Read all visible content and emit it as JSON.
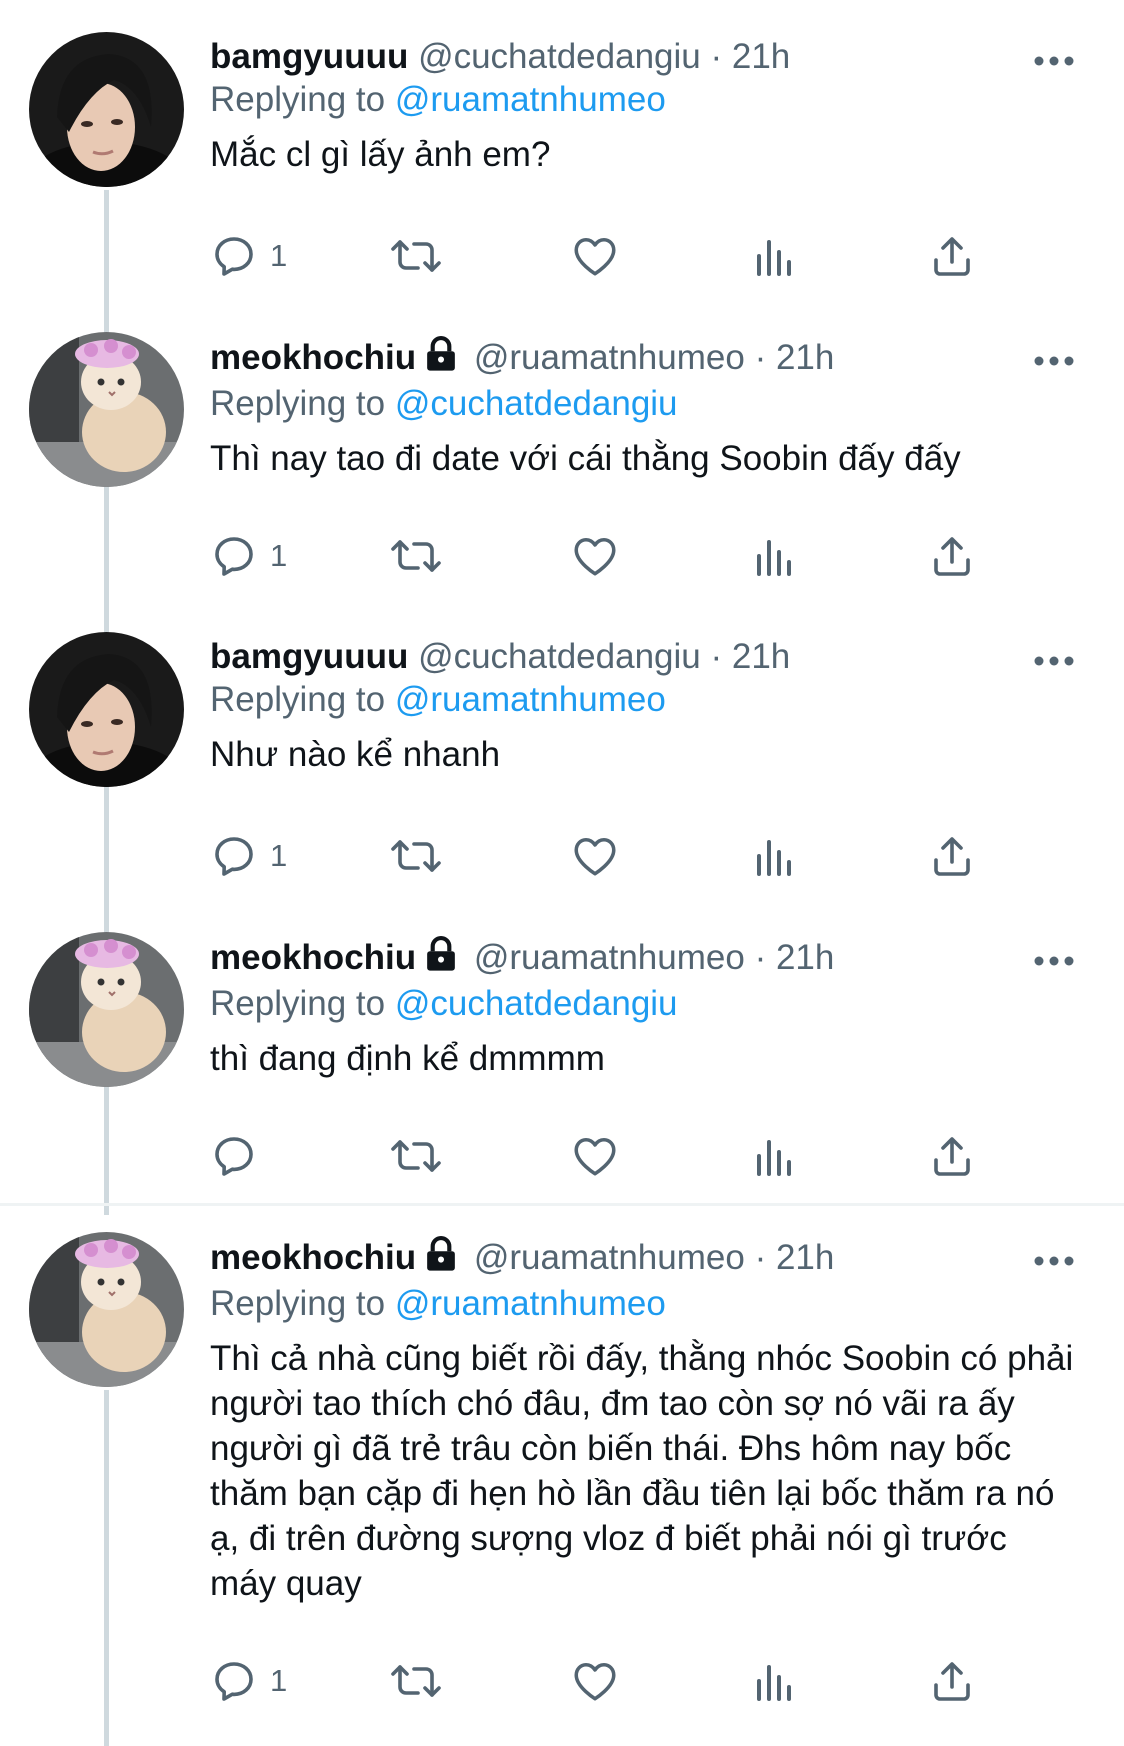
{
  "tweets": [
    {
      "avatar": "person-avatar",
      "name": "bamgyuuuu",
      "locked": false,
      "handle": "@cuchatdedangiu",
      "separator": "·",
      "time": "21h",
      "replying_label": "Replying to",
      "replying_to": "@ruamatnhumeo",
      "text": "Mắc cl gì lấy ảnh em?",
      "reply_count": "1"
    },
    {
      "avatar": "cat-avatar",
      "name": "meokhochiu",
      "locked": true,
      "handle": "@ruamatnhumeo",
      "separator": "·",
      "time": "21h",
      "replying_label": "Replying to",
      "replying_to": "@cuchatdedangiu",
      "text": "Thì nay tao đi date với cái thằng Soobin đấy đấy",
      "reply_count": "1"
    },
    {
      "avatar": "person-avatar",
      "name": "bamgyuuuu",
      "locked": false,
      "handle": "@cuchatdedangiu",
      "separator": "·",
      "time": "21h",
      "replying_label": "Replying to",
      "replying_to": "@ruamatnhumeo",
      "text": "Như nào kể nhanh",
      "reply_count": "1"
    },
    {
      "avatar": "cat-avatar",
      "name": "meokhochiu",
      "locked": true,
      "handle": "@ruamatnhumeo",
      "separator": "·",
      "time": "21h",
      "replying_label": "Replying to",
      "replying_to": "@cuchatdedangiu",
      "text": "thì đang định kể dmmmm",
      "reply_count": ""
    },
    {
      "avatar": "cat-avatar",
      "name": "meokhochiu",
      "locked": true,
      "handle": "@ruamatnhumeo",
      "separator": "·",
      "time": "21h",
      "replying_label": "Replying to",
      "replying_to": "@ruamatnhumeo",
      "text": "Thì cả nhà cũng biết rồi đấy, thằng nhóc Soobin có phải người tao thích chó đâu, đm tao còn sợ nó vãi ra ấy người gì đã trẻ trâu còn biến thái. Đhs hôm nay bốc thăm bạn cặp đi hẹn hò lần đầu tiên lại bốc thăm ra nó ạ, đi trên đường sượng vloz đ biết phải nói gì trước máy quay",
      "reply_count": "1"
    }
  ],
  "icons": {
    "reply": "reply-icon",
    "retweet": "retweet-icon",
    "like": "heart-icon",
    "views": "analytics-icon",
    "share": "share-icon",
    "more": "more-icon",
    "lock": "lock-icon"
  },
  "colors": {
    "text": "#0f1419",
    "secondary": "#536471",
    "link": "#1d9bf0",
    "thread_line": "#cfd9de"
  }
}
